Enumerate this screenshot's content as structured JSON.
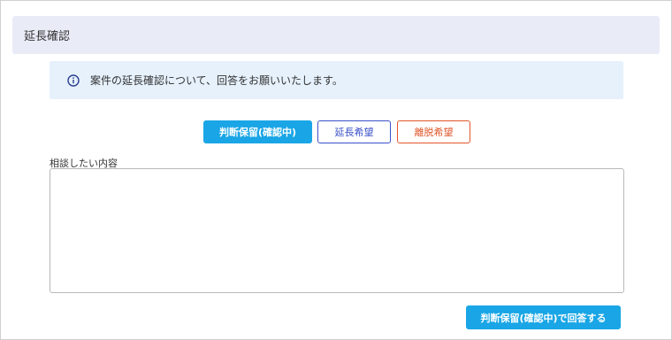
{
  "header": {
    "title": "延長確認"
  },
  "notice": {
    "icon": "info-icon",
    "text": "案件の延長確認について、回答をお願いいたします。"
  },
  "choices": {
    "hold_label": "判断保留(確認中)",
    "extend_label": "延長希望",
    "leave_label": "離脱希望"
  },
  "consult": {
    "label": "相談したい内容",
    "value": "",
    "placeholder": ""
  },
  "submit": {
    "label": "判断保留(確認中)で回答する"
  },
  "colors": {
    "accent": "#1aa6e6",
    "extend": "#3a52c9",
    "leave": "#e2572b",
    "header_bg": "#e9ecf7",
    "notice_bg": "#e6f1fc"
  }
}
